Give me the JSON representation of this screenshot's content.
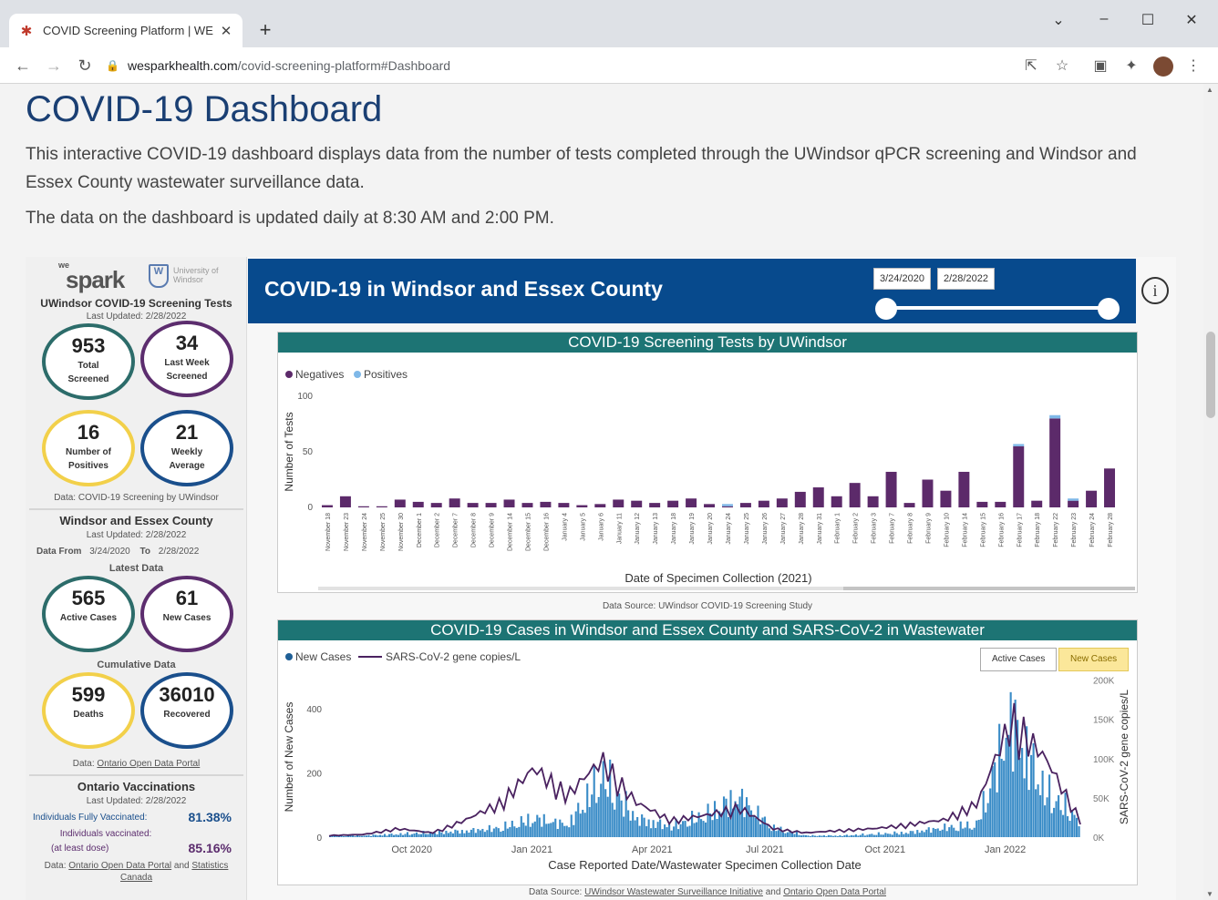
{
  "browser": {
    "tab_title": "COVID Screening Platform | WE S",
    "url_host": "wesparkhealth.com",
    "url_path": "/covid-screening-platform#Dashboard"
  },
  "page": {
    "title": "COVID-19 Dashboard",
    "intro": "This interactive COVID-19 dashboard displays data from the number of tests completed through the UWindsor qPCR screening and Windsor and Essex County wastewater surveillance data.",
    "update_note": "The data on the dashboard is updated daily at 8:30 AM and 2:00 PM."
  },
  "left": {
    "logo_we": "we",
    "logo_spark": "spark",
    "logo_uw_text": "University of Windsor",
    "screening_title": "UWindsor COVID-19 Screening Tests",
    "screening_updated_label": "Last Updated:",
    "screening_updated": "2/28/2022",
    "total_screened": "953",
    "total_screened_label": "Total Screened",
    "last_week": "34",
    "last_week_label": "Last Week Screened",
    "positives": "16",
    "positives_label": "Number of Positives",
    "weekly_avg": "21",
    "weekly_avg_label": "Weekly Average",
    "screening_source": "Data: COVID-19 Screening by UWindsor",
    "county_title": "Windsor and Essex County",
    "county_updated_label": "Last Updated:",
    "county_updated": "2/28/2022",
    "data_from_label": "Data From",
    "data_from": "3/24/2020",
    "data_to_label": "To",
    "data_to": "2/28/2022",
    "latest_label": "Latest Data",
    "active_cases": "565",
    "active_cases_label": "Active Cases",
    "new_cases": "61",
    "new_cases_label": "New Cases",
    "cumulative_label": "Cumulative Data",
    "deaths": "599",
    "deaths_label": "Deaths",
    "recovered": "36010",
    "recovered_label": "Recovered",
    "county_source_prefix": "Data:",
    "county_source_link": "Ontario Open Data Portal",
    "vacc_title": "Ontario Vaccinations",
    "vacc_updated_label": "Last Updated:",
    "vacc_updated": "2/28/2022",
    "fully_label": "Individuals Fully Vaccinated:",
    "fully_pct": "81.38%",
    "one_dose_label": "Individuals vaccinated:",
    "one_dose_label2": "(at least dose)",
    "one_dose_pct": "85.16%",
    "vacc_source_prefix": "Data:",
    "vacc_source_link1": "Ontario Open Data Portal",
    "vacc_source_and": "and",
    "vacc_source_link2": "Statistics Canada"
  },
  "banner": {
    "title": "COVID-19 in Windsor and Essex County",
    "date_start": "3/24/2020",
    "date_end": "2/28/2022",
    "info_icon": "i"
  },
  "chart1_meta": {
    "title": "COVID-19 Screening Tests by UWindsor",
    "source": "Data Source: UWindsor COVID-19 Screening Study",
    "color_neg": "#5c2a6a",
    "color_pos": "#7fb8e8"
  },
  "chart2_meta": {
    "title": "COVID-19 Cases in Windsor and Essex County and SARS-CoV-2 in Wastewater",
    "toggle_active": "Active Cases",
    "toggle_new": "New Cases",
    "source_prefix": "Data Source:",
    "source_link1": "UWindsor Wastewater Surveillance Initiative",
    "source_and": "and",
    "source_link2": "Ontario Open Data Portal",
    "color_bars": "#3a8cc7",
    "color_line": "#4a2260"
  },
  "chart_data": [
    {
      "type": "bar",
      "title": "COVID-19 Screening Tests by UWindsor",
      "xlabel": "Date of Specimen Collection (2021)",
      "ylabel": "Number of Tests",
      "ylim": [
        0,
        100
      ],
      "yticks": [
        0,
        50,
        100
      ],
      "legend": "top-left",
      "categories": [
        "November 18",
        "November 23",
        "November 24",
        "November 25",
        "November 30",
        "December 1",
        "December 2",
        "December 7",
        "December 8",
        "December 9",
        "December 14",
        "December 15",
        "December 16",
        "January 4",
        "January 5",
        "January 6",
        "January 11",
        "January 12",
        "January 13",
        "January 18",
        "January 19",
        "January 20",
        "January 24",
        "January 25",
        "January 26",
        "January 27",
        "January 28",
        "January 31",
        "February 1",
        "February 2",
        "February 3",
        "February 7",
        "February 8",
        "February 9",
        "February 10",
        "February 14",
        "February 15",
        "February 16",
        "February 17",
        "February 18",
        "February 22",
        "February 23",
        "February 24",
        "February 28"
      ],
      "series": [
        {
          "name": "Negatives",
          "values": [
            2,
            10,
            1,
            1,
            7,
            5,
            4,
            8,
            4,
            4,
            7,
            4,
            5,
            4,
            2,
            3,
            7,
            6,
            4,
            6,
            8,
            3,
            1,
            4,
            6,
            8,
            14,
            18,
            10,
            22,
            10,
            32,
            4,
            25,
            15,
            32,
            5,
            5,
            55,
            6,
            80,
            6,
            15,
            35
          ]
        },
        {
          "name": "Positives",
          "values": [
            0,
            0,
            0,
            0,
            0,
            0,
            0,
            0,
            0,
            0,
            0,
            0,
            0,
            0,
            0,
            0,
            0,
            0,
            0,
            0,
            0,
            0,
            2,
            0,
            0,
            0,
            0,
            0,
            0,
            0,
            0,
            0,
            0,
            0,
            0,
            0,
            0,
            0,
            2,
            0,
            3,
            2,
            0,
            0
          ]
        }
      ]
    },
    {
      "type": "bar",
      "title": "COVID-19 Cases in Windsor and Essex County and SARS-CoV-2 in Wastewater",
      "xlabel": "Case Reported Date/Wastewater Specimen Collection Date",
      "ylabel": "Number of New Cases",
      "y2label": "SARS-CoV-2 gene copies/L",
      "ylim": [
        0,
        500
      ],
      "yticks": [
        0,
        200,
        400
      ],
      "y2lim": [
        0,
        200000
      ],
      "y2ticks": [
        "0K",
        "50K",
        "100K",
        "150K",
        "200K"
      ],
      "xticks": [
        "Oct 2020",
        "Jan 2021",
        "Apr 2021",
        "Jul 2021",
        "Oct 2021",
        "Jan 2022"
      ],
      "legend": "top-left",
      "series": [
        {
          "name": "New Cases",
          "kind": "bar",
          "monthly_approx": [
            5,
            5,
            10,
            15,
            20,
            30,
            60,
            40,
            200,
            60,
            35,
            70,
            130,
            30,
            5,
            5,
            10,
            15,
            30,
            40,
            380,
            150,
            60
          ]
        },
        {
          "name": "SARS-CoV-2 gene copies/L",
          "kind": "line",
          "monthly_approx": [
            2000,
            3000,
            10000,
            5000,
            20000,
            40000,
            80000,
            50000,
            90000,
            40000,
            20000,
            25000,
            35000,
            10000,
            5000,
            8000,
            10000,
            15000,
            20000,
            40000,
            140000,
            90000,
            20000
          ]
        }
      ]
    }
  ]
}
